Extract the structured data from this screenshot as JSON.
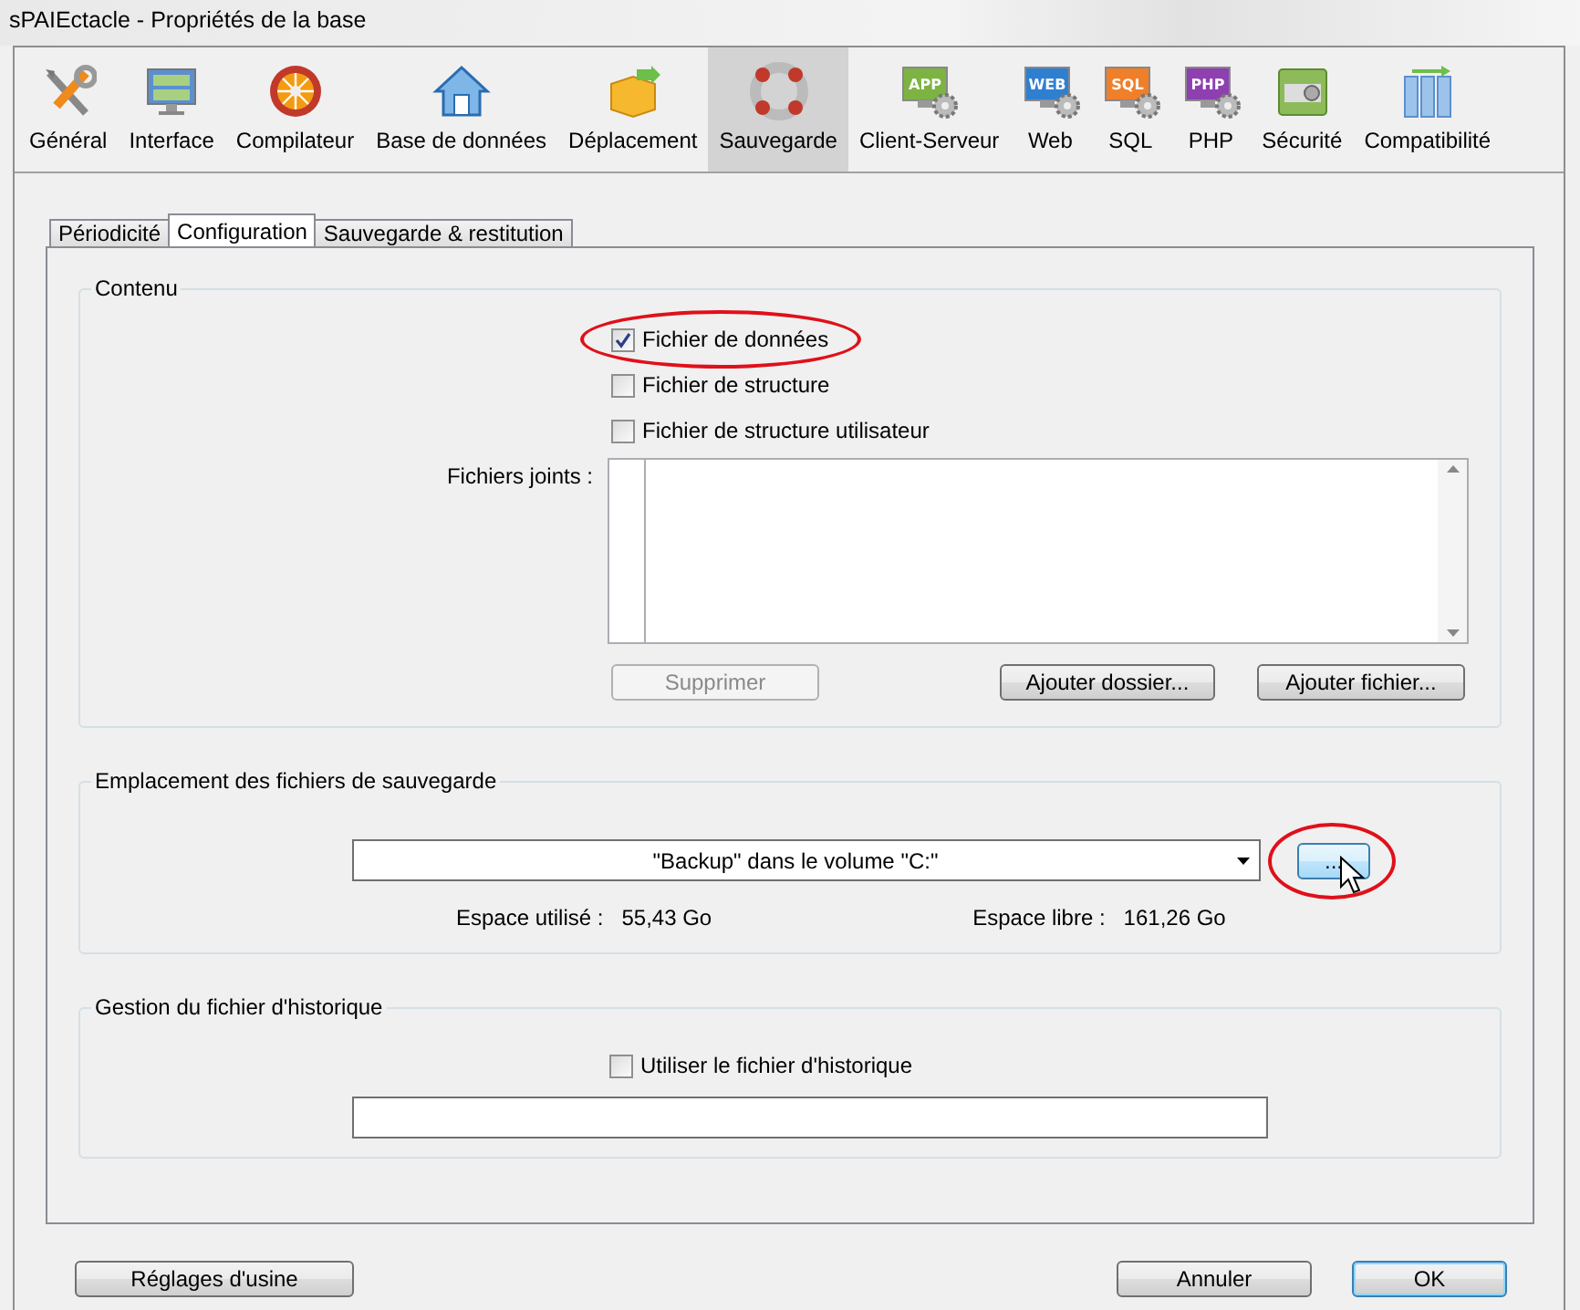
{
  "window": {
    "title": "sPAIEctacle - Propriétés de la base"
  },
  "toolbar": [
    {
      "label": "Général",
      "kind": "tools",
      "selected": false
    },
    {
      "label": "Interface",
      "kind": "monitor",
      "selected": false
    },
    {
      "label": "Compilateur",
      "kind": "wheel",
      "selected": false
    },
    {
      "label": "Base de données",
      "kind": "house",
      "selected": false
    },
    {
      "label": "Déplacement",
      "kind": "box",
      "selected": false
    },
    {
      "label": "Sauvegarde",
      "kind": "lifebuoy",
      "selected": true
    },
    {
      "label": "Client-Serveur",
      "kind": "badge",
      "badge": "APP",
      "color": "#7cb342",
      "selected": false
    },
    {
      "label": "Web",
      "kind": "badge",
      "badge": "WEB",
      "color": "#2f7fd0",
      "selected": false
    },
    {
      "label": "SQL",
      "kind": "badge",
      "badge": "SQL",
      "color": "#f07f2a",
      "selected": false
    },
    {
      "label": "PHP",
      "kind": "badge",
      "badge": "PHP",
      "color": "#8e3fb0",
      "selected": false
    },
    {
      "label": "Sécurité",
      "kind": "safe",
      "selected": false
    },
    {
      "label": "Compatibilité",
      "kind": "binders",
      "selected": false
    }
  ],
  "tabs": [
    {
      "label": "Périodicité",
      "selected": false
    },
    {
      "label": "Configuration",
      "selected": true
    },
    {
      "label": "Sauvegarde & restitution",
      "selected": false
    }
  ],
  "content": {
    "title": "Contenu",
    "checkboxes": [
      {
        "label": "Fichier de données",
        "checked": true,
        "circled": true
      },
      {
        "label": "Fichier de structure",
        "checked": false,
        "circled": false
      },
      {
        "label": "Fichier de structure utilisateur",
        "checked": false,
        "circled": false
      }
    ],
    "attached_files_label": "Fichiers joints :",
    "buttons": [
      {
        "label": "Supprimer",
        "disabled": true
      },
      {
        "label": "Ajouter dossier...",
        "disabled": false
      },
      {
        "label": "Ajouter fichier...",
        "disabled": false
      }
    ]
  },
  "location": {
    "title": "Emplacement des fichiers de sauvegarde",
    "path": "\"Backup\" dans le volume \"C:\"",
    "browse_button": {
      "label": "...",
      "circled": true
    },
    "used_label": "Espace utilisé :",
    "used_value": "55,43 Go",
    "free_label": "Espace libre :",
    "free_value": "161,26 Go"
  },
  "history": {
    "title": "Gestion du fichier d'historique",
    "checkbox": {
      "label": "Utiliser le fichier d'historique",
      "checked": false
    }
  },
  "footer": [
    {
      "label": "Réglages d'usine",
      "default": false
    },
    {
      "label": "Annuler",
      "default": false
    },
    {
      "label": "OK",
      "default": true
    }
  ]
}
